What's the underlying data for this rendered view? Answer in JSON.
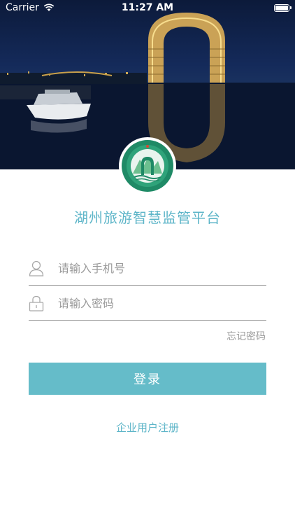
{
  "status_bar": {
    "carrier": "Carrier",
    "time": "11:27 AM",
    "wifi_icon": "wifi-icon",
    "battery_icon": "battery-icon"
  },
  "hero": {
    "image": "night-lakeside-hotel-with-yacht"
  },
  "logo": {
    "icon": "app-logo-emblem"
  },
  "app": {
    "title": "湖州旅游智慧监管平台"
  },
  "login": {
    "phone_placeholder": "请输入手机号",
    "phone_value": "",
    "password_placeholder": "请输入密码",
    "password_value": "",
    "forgot_label": "忘记密码",
    "submit_label": "登录",
    "register_label": "企业用户注册"
  },
  "colors": {
    "accent": "#65bcc9",
    "title": "#5db5c8",
    "placeholder": "#9b9b9b",
    "divider": "#9a9a9a"
  }
}
